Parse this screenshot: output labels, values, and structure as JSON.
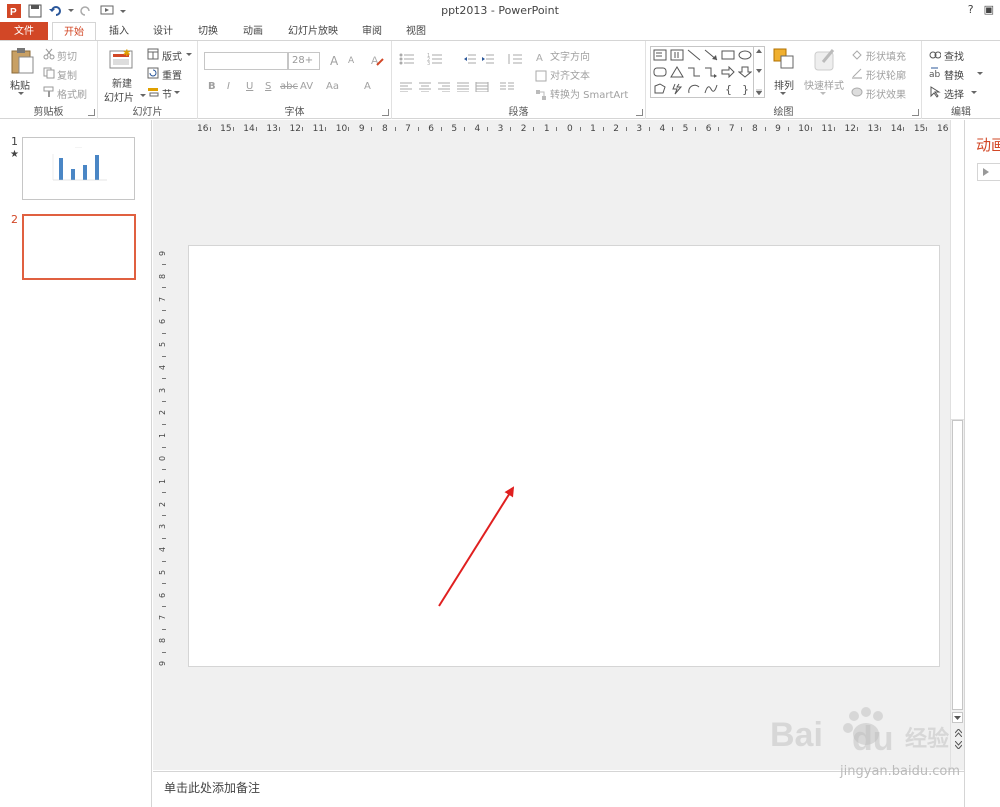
{
  "window": {
    "title": "ppt2013 - PowerPoint",
    "help": "?",
    "restore": "▣"
  },
  "tabs": [
    "文件",
    "开始",
    "插入",
    "设计",
    "切换",
    "动画",
    "幻灯片放映",
    "审阅",
    "视图"
  ],
  "ribbon": {
    "clipboard": {
      "paste": "粘贴",
      "cut": "剪切",
      "copy": "复制",
      "format_painter": "格式刷",
      "label": "剪贴板"
    },
    "slides": {
      "new_slide_top": "新建",
      "new_slide_bottom": "幻灯片",
      "layout": "版式",
      "reset": "重置",
      "section": "节",
      "label": "幻灯片"
    },
    "font": {
      "font_size": "28+",
      "bold": "B",
      "italic": "I",
      "underline": "U",
      "strike": "S",
      "shadow": "abc",
      "spacing": "AV",
      "case": "Aa",
      "color": "A",
      "grow": "A",
      "shrink": "A",
      "clear": "A",
      "label": "字体"
    },
    "paragraph": {
      "text_direction": "文字方向",
      "align_text": "对齐文本",
      "convert_smartart": "转换为 SmartArt",
      "label": "段落"
    },
    "drawing": {
      "arrange": "排列",
      "quick_styles": "快速样式",
      "shape_fill": "形状填充",
      "shape_outline": "形状轮廓",
      "shape_effects": "形状效果",
      "label": "绘图"
    },
    "editing": {
      "find": "查找",
      "replace": "替换",
      "select": "选择",
      "label": "编辑"
    }
  },
  "thumbnails": [
    {
      "number": "1",
      "marker": "★"
    },
    {
      "number": "2",
      "marker": ""
    }
  ],
  "notes_placeholder": "单击此处添加备注",
  "right_pane": {
    "title": "动画"
  },
  "ruler": {
    "horizontal": [
      "16",
      "15",
      "14",
      "13",
      "12",
      "11",
      "10",
      "9",
      "8",
      "7",
      "6",
      "5",
      "4",
      "3",
      "2",
      "1",
      "0",
      "1",
      "2",
      "3",
      "4",
      "5",
      "6",
      "7",
      "8",
      "9",
      "10",
      "11",
      "12",
      "13",
      "14",
      "15",
      "16"
    ],
    "vertical": [
      "9",
      "8",
      "7",
      "6",
      "5",
      "4",
      "3",
      "2",
      "1",
      "0",
      "1",
      "2",
      "3",
      "4",
      "5",
      "6",
      "7",
      "8",
      "9"
    ]
  },
  "colors": {
    "accent": "#d24726",
    "ribbon_border": "#d5d5d5",
    "workspace": "#f0f0f0",
    "arrow": "#e02020"
  },
  "watermark": {
    "logo": "Bai du 经验",
    "url": "jingyan.baidu.com"
  }
}
